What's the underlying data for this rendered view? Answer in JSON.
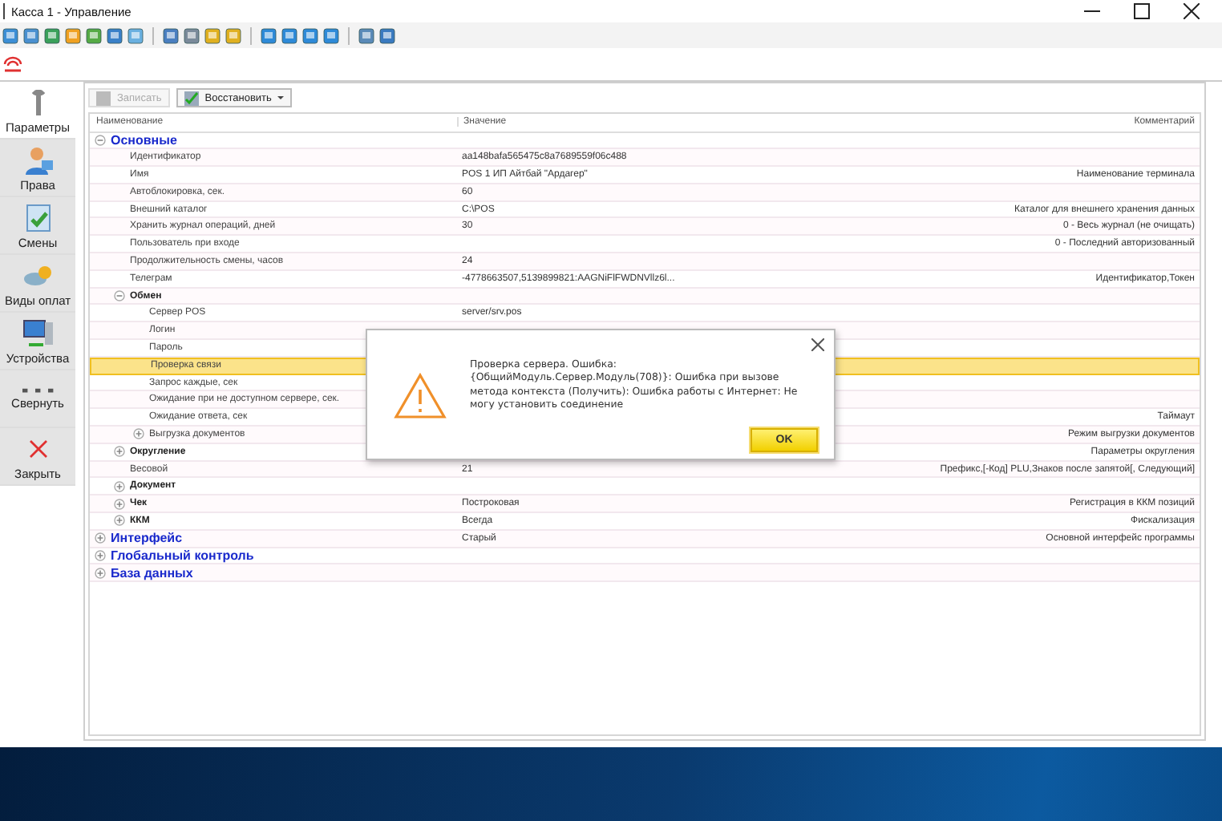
{
  "window": {
    "title": "Касса 1 - Управление"
  },
  "sidebar": {
    "items": [
      {
        "label": "Параметры",
        "selected": true
      },
      {
        "label": "Права",
        "selected": false
      },
      {
        "label": "Смены",
        "selected": false
      },
      {
        "label": "Виды оплат",
        "selected": false
      },
      {
        "label": "Устройства",
        "selected": false
      },
      {
        "label": "Свернуть",
        "selected": false
      },
      {
        "label": "Закрыть",
        "selected": false
      }
    ]
  },
  "toolbar": {
    "buttons": [
      {
        "label": "Записать",
        "disabled": true,
        "dropdown": false
      },
      {
        "label": "Восстановить",
        "disabled": false,
        "dropdown": true
      }
    ]
  },
  "table": {
    "columns": [
      "Наименование",
      "Значение",
      "Комментарий"
    ],
    "rows": [
      {
        "kind": "section",
        "name": "Основные",
        "expanded": true,
        "selected": false,
        "children": [
          {
            "kind": "item",
            "name": "Идентификатор",
            "value": "aa148bafa565475c8a7689559f06c488",
            "selected": false
          },
          {
            "kind": "item",
            "name": "Имя",
            "value": "POS 1 ИП Айтбай \"Ардагер\"",
            "comment": "Наименование терминала",
            "selected": false
          },
          {
            "kind": "item",
            "name": "Автоблокировка, сек.",
            "value": "60",
            "selected": false
          },
          {
            "kind": "item",
            "name": "Внешний каталог",
            "value": "C:\\POS",
            "comment": "Каталог для внешнего хранения данных",
            "selected": false
          },
          {
            "kind": "item",
            "name": "Хранить журнал операций, дней",
            "value": "30",
            "comment": "0 - Весь журнал (не очищать)",
            "selected": false
          },
          {
            "kind": "item",
            "name": "Пользователь при входе",
            "comment": "0 - Последний авторизованный",
            "selected": false
          },
          {
            "kind": "item",
            "name": "Продолжительность смены, часов",
            "value": "24",
            "selected": false
          },
          {
            "kind": "item",
            "name": "Телеграм",
            "value": "-4778663507,5139899821:AAGNiFlFWDNVllz6l...",
            "comment": "Идентификатор,Токен",
            "selected": false
          },
          {
            "kind": "group",
            "name": "Обмен",
            "expanded": true,
            "selected": false,
            "children": [
              {
                "kind": "item",
                "name": "Сервер POS",
                "value": "server/srv.pos",
                "selected": false
              },
              {
                "kind": "item",
                "name": "Логин",
                "selected": false
              },
              {
                "kind": "item",
                "name": "Пароль",
                "selected": false
              },
              {
                "kind": "item",
                "name": "Проверка связи",
                "selected": true
              },
              {
                "kind": "item",
                "name": "Запрос каждые, сек",
                "selected": false
              },
              {
                "kind": "item",
                "name": "Ожидание при не доступном сервере, сек.",
                "selected": false
              },
              {
                "kind": "item",
                "name": "Ожидание ответа, сек",
                "comment": "Таймаут",
                "selected": false
              },
              {
                "kind": "item",
                "name": "Выгрузка документов",
                "expanded": false,
                "comment": "Режим выгрузки документов",
                "selected": false
              }
            ]
          },
          {
            "kind": "group",
            "name": "Округление",
            "expanded": false,
            "comment": "Параметры округления",
            "selected": false
          },
          {
            "kind": "item",
            "name": "Весовой",
            "value": "21",
            "comment": "Префикс,[-Код] PLU,Знаков после запятой[, Следующий]",
            "selected": false
          },
          {
            "kind": "group",
            "name": "Документ",
            "expanded": false,
            "selected": false
          },
          {
            "kind": "group",
            "name": "Чек",
            "expanded": false,
            "value": "Построковая",
            "comment": "Регистрация в ККМ позиций",
            "selected": false
          },
          {
            "kind": "group",
            "name": "ККМ",
            "expanded": false,
            "value": "Всегда",
            "comment": "Фискализация",
            "selected": false
          }
        ]
      },
      {
        "kind": "section",
        "name": "Интерфейс",
        "expanded": false,
        "value": "Старый",
        "comment": "Основной интерфейс программы",
        "selected": false
      },
      {
        "kind": "section",
        "name": "Глобальный контроль",
        "expanded": false,
        "selected": false
      },
      {
        "kind": "section",
        "name": "База данных",
        "expanded": false,
        "selected": false
      }
    ]
  },
  "dialog": {
    "message": "Проверка сервера. Ошибка: {ОбщийМодуль.Сервер.Модуль(708)}: Ошибка при вызове метода контекста (Получить): Ошибка работы с Интернет:  Не могу установить соединение",
    "button": "OK"
  }
}
